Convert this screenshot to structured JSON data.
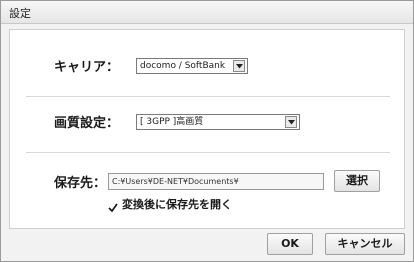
{
  "window": {
    "title": "設定"
  },
  "carrier": {
    "label": "キャリア：",
    "selected": "docomo / SoftBank"
  },
  "quality": {
    "label": "画質設定：",
    "selected": "[ 3GPP ]高画質"
  },
  "save": {
    "label": "保存先：",
    "path": "C:¥Users¥DE-NET¥Documents¥",
    "browse_label": "選択",
    "open_after_label": "変換後に保存先を開く",
    "open_after_checked": true
  },
  "footer": {
    "ok_label": "OK",
    "cancel_label": "キャンセル"
  }
}
